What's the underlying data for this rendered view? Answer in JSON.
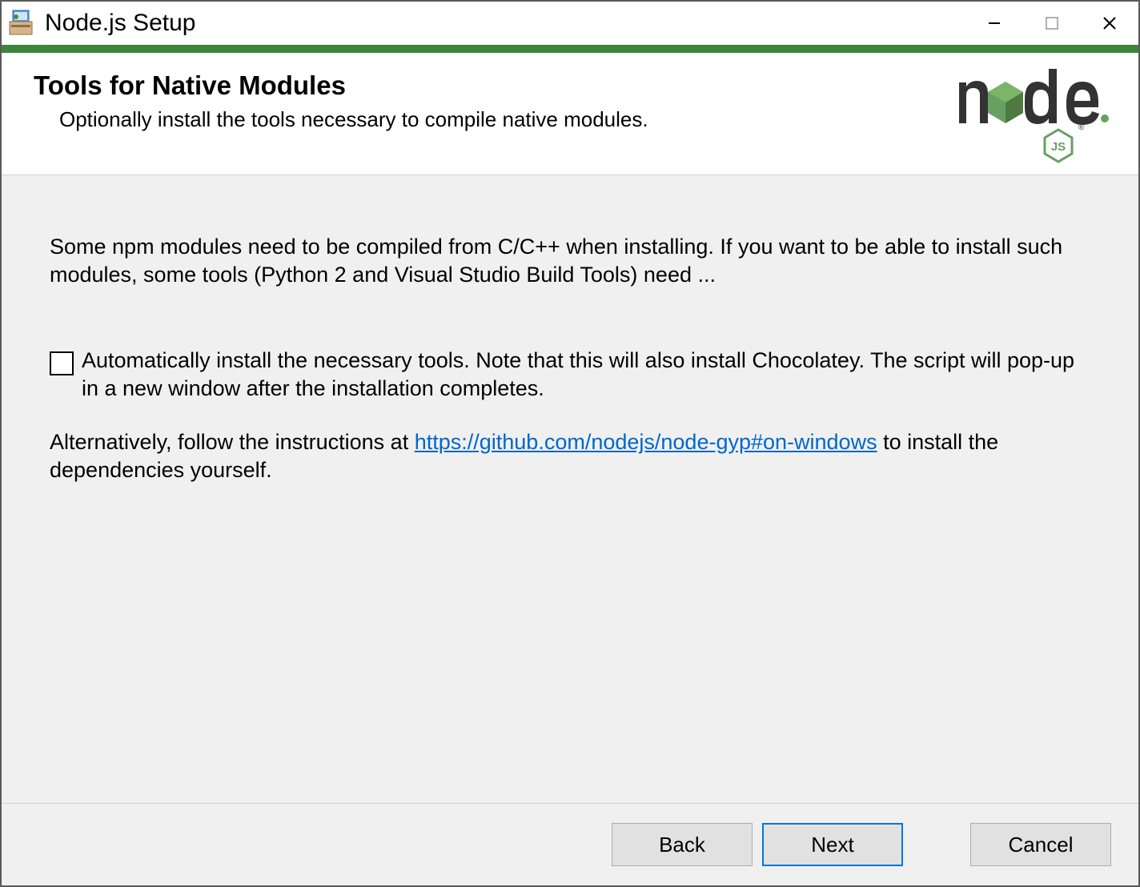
{
  "titlebar": {
    "title": "Node.js Setup"
  },
  "header": {
    "title": "Tools for Native Modules",
    "subtitle": "Optionally install the tools necessary to compile native modules."
  },
  "content": {
    "paragraph1": "Some npm modules need to be compiled from C/C++ when installing. If you want to be able to install such modules, some tools (Python 2 and Visual Studio Build Tools) need ...",
    "checkbox_label": "Automatically install the necessary tools. Note that this will also install Chocolatey. The script will pop-up in a new window after the installation completes.",
    "checkbox_checked": false,
    "paragraph3_prefix": "Alternatively, follow the instructions at ",
    "paragraph3_link_text": "https://github.com/nodejs/node-gyp#on-windows",
    "paragraph3_suffix": " to install the dependencies yourself."
  },
  "footer": {
    "back": "Back",
    "next": "Next",
    "cancel": "Cancel"
  }
}
